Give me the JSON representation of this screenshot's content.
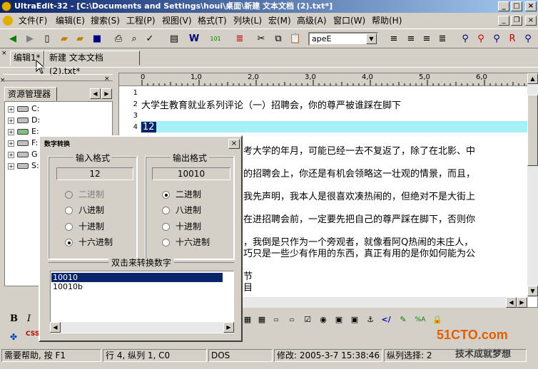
{
  "window": {
    "title": "UltraEdit-32 - [C:\\Documents and Settings\\houi\\桌面\\新建 文本文档 (2).txt*]"
  },
  "menu": [
    "文件(F)",
    "编辑(E)",
    "搜索(S)",
    "工程(P)",
    "视图(V)",
    "格式(T)",
    "列块(L)",
    "宏(M)",
    "高级(A)",
    "窗口(W)",
    "帮助(H)"
  ],
  "toolbar": {
    "font_value": "apeE"
  },
  "tabs": [
    {
      "label": "编辑1*"
    },
    {
      "label": "新建 文本文档 (2).txt*"
    }
  ],
  "explorer": {
    "title": "资源管理器",
    "drives": [
      "C:",
      "D:",
      "E:",
      "F:",
      "G:",
      "S:"
    ]
  },
  "ruler": [
    "0",
    "1,0",
    "2,0",
    "3,0",
    "4,0",
    "5,0",
    "6,0"
  ],
  "editor": {
    "lines": [
      {
        "n": "1",
        "text": ""
      },
      {
        "n": "2",
        "text": "大学生教育就业系列评论（一）招聘会，你的尊严被谁踩在脚下"
      },
      {
        "n": "3",
        "text": ""
      },
      {
        "n": "4",
        "text": "12"
      }
    ],
    "partial_lines": [
      "考大学的年月，可能已经一去不复返了，除了在北影、中",
      "的招聘会上，你还是有机会领略这一壮观的情景，而且，",
      "我先声明，我本人是很喜欢凑热闹的，但绝对不是大街上",
      "在进招聘会前，一定要先把自己的尊严踩在脚下，否则你",
      "，我倒是只作为一个旁观者，就像看阿Q热闹的未庄人，",
      "巧只是一些少有作用的东西，真正有用的是你如何能为公",
      "节",
      "目"
    ]
  },
  "dialog": {
    "title": "数字转换",
    "input_group": "输入格式",
    "output_group": "输出格式",
    "input_value": "12",
    "output_value": "10010",
    "input_options": [
      "二进制",
      "八进制",
      "十进制",
      "十六进制"
    ],
    "output_options": [
      "二进制",
      "八进制",
      "十进制",
      "十六进制"
    ],
    "convert_label": "双击来转换数字",
    "results": [
      "10010",
      "10010b"
    ]
  },
  "bottom_toolbar": {
    "bold": "B",
    "italic": "I"
  },
  "logo": {
    "brand": "51CTO.com",
    "tagline": "技术成就梦想"
  },
  "status": {
    "help": "需要帮助, 按 F1",
    "position": "行 4, 纵列 1, C0",
    "format": "DOS",
    "modified": "修改: 2005-3-7 15:38:46",
    "selection": "纵列选择: 2"
  }
}
